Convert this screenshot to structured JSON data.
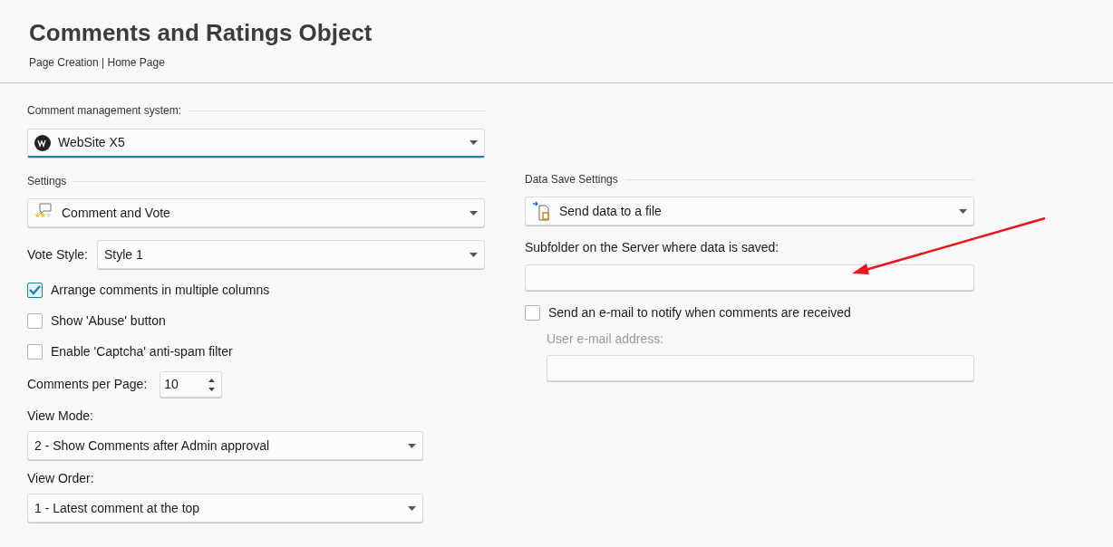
{
  "header": {
    "title": "Comments and Ratings Object",
    "breadcrumb": "Page Creation | Home Page"
  },
  "left": {
    "system_section": "Comment management system:",
    "system": {
      "value": "WebSite X5"
    },
    "settings_section": "Settings",
    "mode": {
      "value": "Comment and Vote"
    },
    "vote_style": {
      "label": "Vote Style:",
      "value": "Style 1"
    },
    "options": [
      {
        "label": "Arrange comments in multiple columns",
        "checked": true
      },
      {
        "label": "Show 'Abuse' button",
        "checked": false
      },
      {
        "label": "Enable 'Captcha' anti-spam filter",
        "checked": false
      }
    ],
    "per_page": {
      "label": "Comments per Page:",
      "value": "10"
    },
    "view_mode": {
      "label": "View Mode:",
      "value": "2 - Show Comments after Admin approval"
    },
    "view_order": {
      "label": "View Order:",
      "value": "1 - Latest comment at the top"
    }
  },
  "right": {
    "section": "Data Save Settings",
    "save": {
      "value": "Send data to a file"
    },
    "subfolder": {
      "label": "Subfolder on the Server where data is saved:"
    },
    "notify": {
      "label": "Send an e-mail to notify when comments are received",
      "checked": false
    },
    "email": {
      "label": "User e-mail address:",
      "disabled": true
    }
  }
}
